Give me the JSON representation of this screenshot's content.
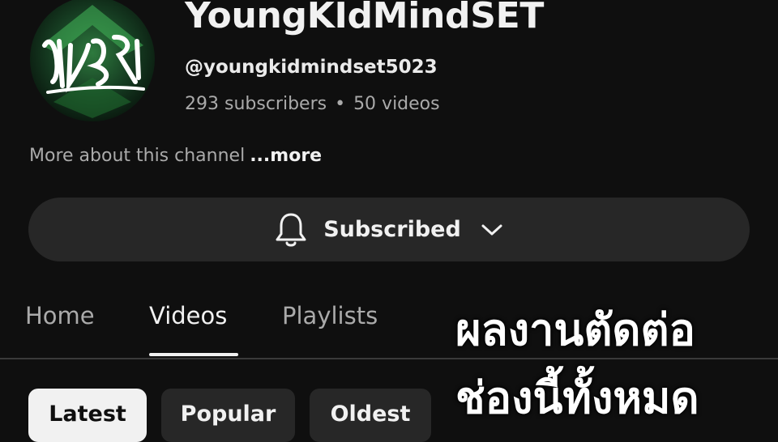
{
  "channel": {
    "name": "YoungKIdMindSET",
    "handle": "@youngkidmindset5023",
    "subscribers": "293 subscribers",
    "separator": "•",
    "videos": "50 videos",
    "about_text": "More about this channel",
    "about_more": "...more"
  },
  "subscribe": {
    "label": "Subscribed",
    "icon": "bell-icon",
    "dropdown_icon": "chevron-down-icon"
  },
  "tabs": [
    {
      "label": "Home",
      "active": false
    },
    {
      "label": "Videos",
      "active": true
    },
    {
      "label": "Playlists",
      "active": false
    }
  ],
  "chips": [
    {
      "label": "Latest",
      "selected": true
    },
    {
      "label": "Popular",
      "selected": false
    },
    {
      "label": "Oldest",
      "selected": false
    }
  ],
  "overlay": {
    "line1": "ผลงานตัดต่อ",
    "line2": "ช่องนี้ทั้งหมด"
  },
  "colors": {
    "background": "#0f0f0f",
    "button": "#272727",
    "text_primary": "#f1f1f1",
    "text_secondary": "#aaaaaa",
    "avatar_accent": "#2e7a3e"
  }
}
